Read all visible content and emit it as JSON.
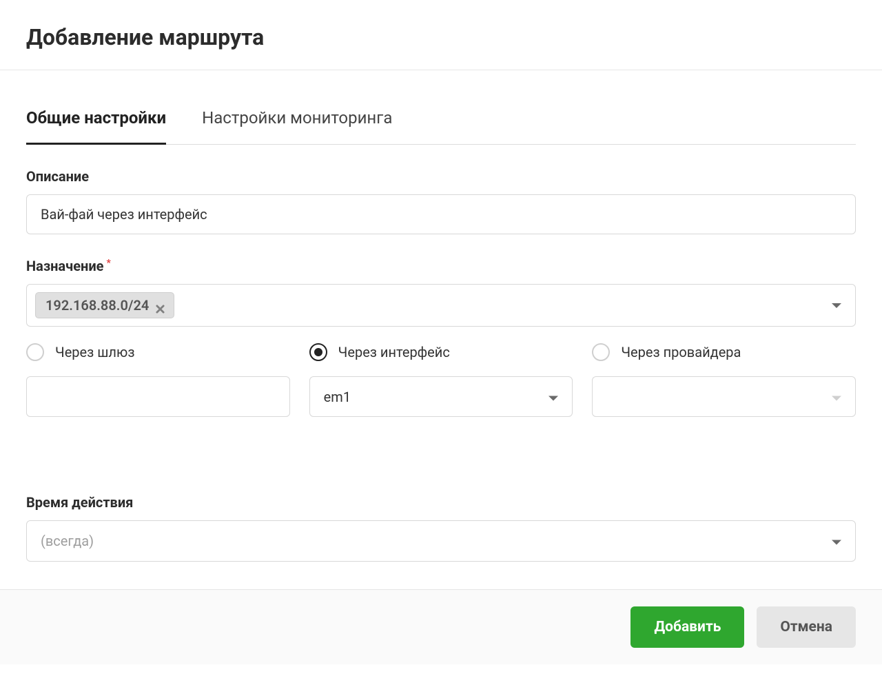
{
  "header": {
    "title": "Добавление маршрута"
  },
  "tabs": [
    {
      "label": "Общие настройки",
      "active": true
    },
    {
      "label": "Настройки мониторинга",
      "active": false
    }
  ],
  "form": {
    "description": {
      "label": "Описание",
      "value": "Вай-фай через интерфейс"
    },
    "destination": {
      "label": "Назначение",
      "required_marker": "*",
      "tags": [
        {
          "text": "192.168.88.0/24"
        }
      ]
    },
    "route_via": {
      "options": {
        "gateway": {
          "label": "Через шлюз",
          "checked": false,
          "value": ""
        },
        "interface": {
          "label": "Через интерфейс",
          "checked": true,
          "value": "em1"
        },
        "provider": {
          "label": "Через провайдера",
          "checked": false,
          "value": ""
        }
      }
    },
    "active_time": {
      "label": "Время действия",
      "placeholder": "(всегда)"
    }
  },
  "footer": {
    "submit": "Добавить",
    "cancel": "Отмена"
  }
}
